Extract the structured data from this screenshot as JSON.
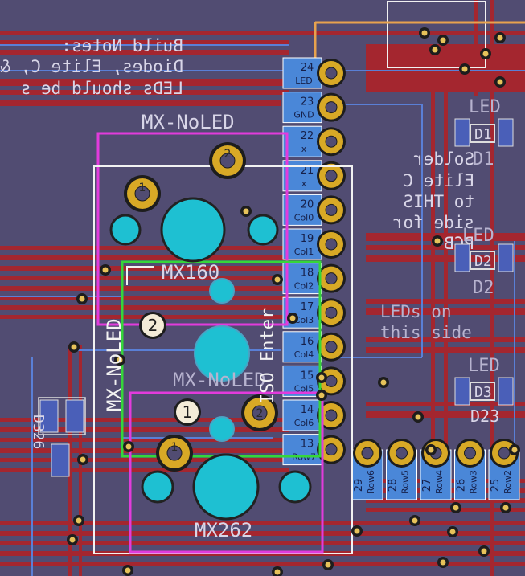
{
  "notes": {
    "build_notes": [
      "Build Notes:",
      "Diodes, Elite C, &",
      "LEDs should be s"
    ],
    "solder_notes": [
      "Solder",
      "Elite C",
      "to THIS",
      "side for",
      "PCB"
    ],
    "leds_note": [
      "LEDs on",
      "this side"
    ]
  },
  "footprints": {
    "mx_noled_top": "MX-NoLED",
    "mx_noled_side": "MX-NoLED",
    "mx160": "MX160",
    "mx262": "MX262",
    "mx_noled_mid": "MX-NoLED",
    "iso_enter": "ISO Enter"
  },
  "callouts": {
    "two": "2",
    "one": "1"
  },
  "pins_right": [
    {
      "num": "24",
      "net": "LED"
    },
    {
      "num": "23",
      "net": "GND"
    },
    {
      "num": "22",
      "net": "x"
    },
    {
      "num": "21",
      "net": "x"
    },
    {
      "num": "20",
      "net": "Col0"
    },
    {
      "num": "19",
      "net": "Col1"
    },
    {
      "num": "18",
      "net": "Col2"
    },
    {
      "num": "17",
      "net": "Col3"
    },
    {
      "num": "16",
      "net": "Col4"
    },
    {
      "num": "15",
      "net": "Col5"
    },
    {
      "num": "14",
      "net": "Col6"
    },
    {
      "num": "13",
      "net": "Row7"
    }
  ],
  "pins_bottom": [
    {
      "num": "29",
      "net": "Row6"
    },
    {
      "num": "28",
      "net": "Row5"
    },
    {
      "num": "27",
      "net": "Row4"
    },
    {
      "num": "26",
      "net": "Row3"
    },
    {
      "num": "25",
      "net": "Row2"
    }
  ],
  "right_labels": {
    "led_a": "LED",
    "d1": "D1",
    "led_b": "LED",
    "d2": "D2",
    "led_c": "LED",
    "d3": "D3",
    "d23": "D23"
  },
  "left_label": "D326",
  "pad_one": "1",
  "pad_two": "2",
  "colors": {
    "board": "#514c72",
    "copper": "#a4262f",
    "pad": "#d8a926",
    "hole": "#1ec0d2",
    "outline_magenta": "#e23bdc",
    "outline_green": "#35d63a",
    "outline_white": "#f2f2f2"
  }
}
